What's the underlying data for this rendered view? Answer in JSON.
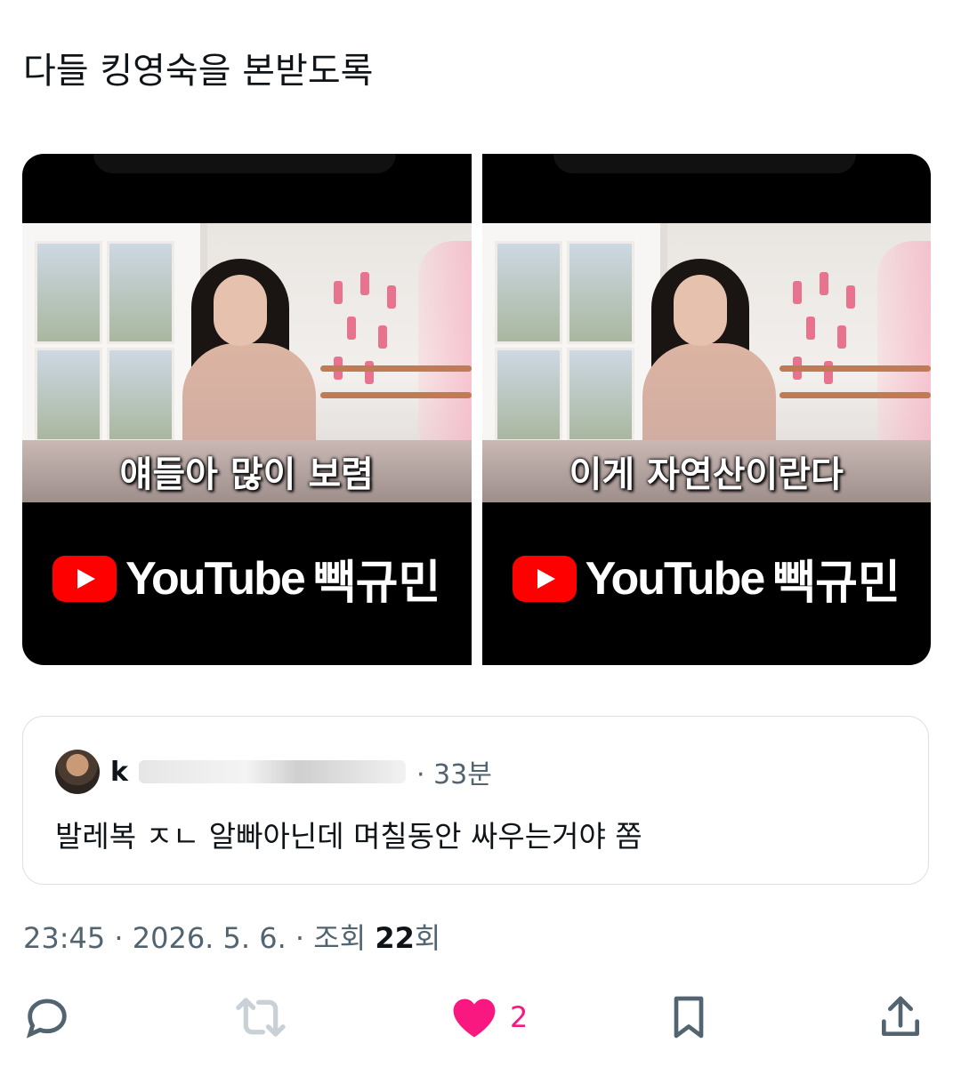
{
  "post": {
    "text": "다들 킹영숙을 본받도록"
  },
  "media": [
    {
      "caption": "얘들아 많이 보렴",
      "brand": "YouTube",
      "channel": "빽규민"
    },
    {
      "caption": "이게 자연산이란다",
      "brand": "YouTube",
      "channel": "빽규민"
    }
  ],
  "quote": {
    "author": "k",
    "time": "· 33분",
    "text": "발레복 ㅈㄴ 알빠아닌데 며칠동안 싸우는거야 쫌"
  },
  "meta": {
    "time": "23:45",
    "date": "· 2026. 5. 6. ·",
    "views_label": "조회",
    "views_count": "22",
    "views_suffix": "회"
  },
  "actions": {
    "reply_icon": "reply-icon",
    "retweet_icon": "retweet-icon",
    "like_icon": "heart-icon",
    "like_count": "2",
    "bookmark_icon": "bookmark-icon",
    "share_icon": "share-icon",
    "like_color": "#f91880",
    "icon_color": "#536471"
  }
}
